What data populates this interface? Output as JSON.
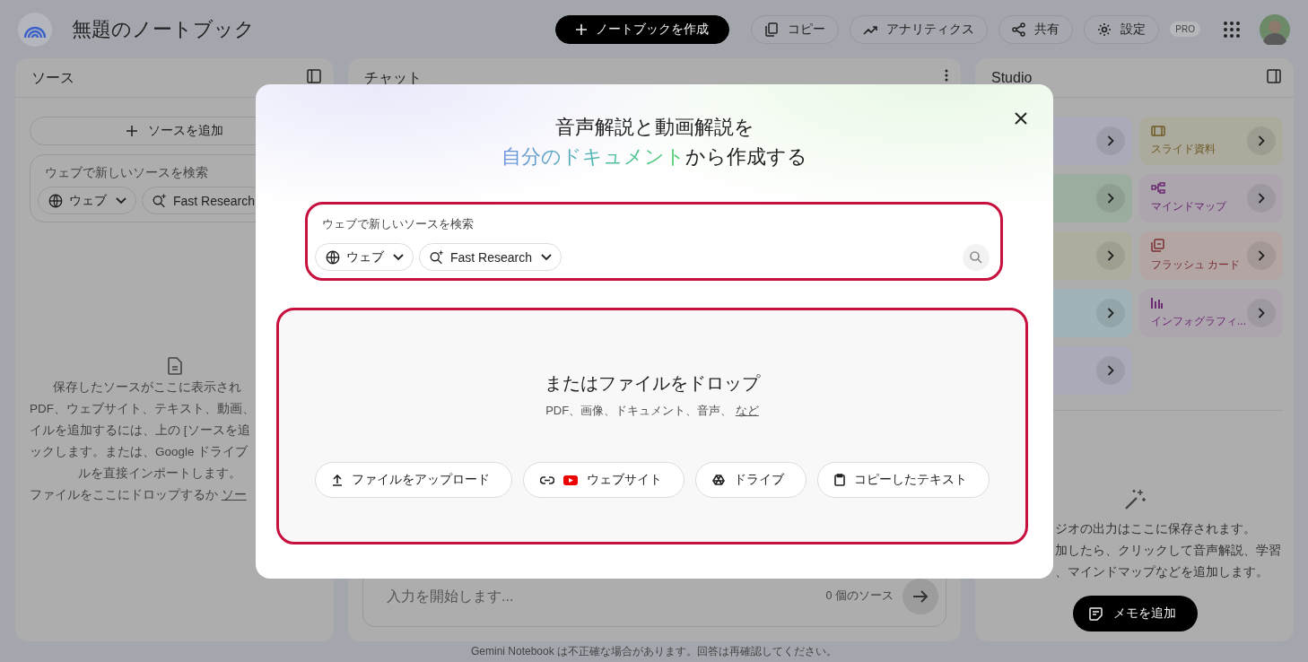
{
  "header": {
    "title": "無題のノートブック",
    "buttons": [
      {
        "label": "ノートブックを作成",
        "kind": "create"
      },
      {
        "label": "コピー",
        "kind": "copy"
      },
      {
        "label": "アナリティクス",
        "kind": "analytics"
      },
      {
        "label": "共有",
        "kind": "share"
      },
      {
        "label": "設定",
        "kind": "settings"
      }
    ],
    "badge": "PRO"
  },
  "sources_panel": {
    "title": "ソース",
    "add_button": "ソースを追加",
    "search": {
      "placeholder": "ウェブで新しいソースを検索",
      "chips": [
        {
          "label": "ウェブ",
          "kind": "web"
        },
        {
          "label": "Fast Research",
          "kind": "research"
        }
      ]
    },
    "empty_lines": [
      "保存したソースがここに表示され",
      "PDF、ウェブサイト、テキスト、動画、",
      "イルを追加するには、上の [ソースを追",
      "ックします。または、Google ドライブ",
      "ルを直接インポートします。",
      "ファイルをここにドロップするか "
    ],
    "empty_link": "ソー"
  },
  "chat_panel": {
    "title": "チャット",
    "input": {
      "placeholder": "入力を開始します..."
    },
    "source_count": "0 個のソース"
  },
  "studio_panel": {
    "title": "Studio",
    "cards": [
      {
        "color": "#a9abb8"
      },
      {
        "color": "#abaa9d",
        "label": "スライド資料",
        "kind": "slides"
      },
      {
        "color": "#9bad9f"
      },
      {
        "color": "#aca5ae",
        "label": "マインドマップ",
        "kind": "mindmap"
      },
      {
        "color": "#adac9e"
      },
      {
        "color": "#b2a5a4",
        "label": "フラッシュ カード",
        "kind": "flashcards"
      },
      {
        "color": "#a0b3b8"
      },
      {
        "color": "#aca5ae",
        "label": "インフォグラフィ...",
        "kind": "infographic"
      },
      {
        "color": "#a9abb8"
      }
    ],
    "empty_lines": [
      "ジオの出力はここに保存されます。",
      "加したら、クリックして音声解説、学習",
      "、マインドマップなどを追加します。"
    ],
    "add_note_button": "メモを追加"
  },
  "footer": "Gemini Notebook は不正確な場合があります。回答は再確認してください。",
  "dialog": {
    "title_line_1": "音声解説と動画解説を",
    "title_highlight": "自分のドキュメント",
    "title_rest": "から作成する",
    "search": {
      "placeholder": "ウェブで新しいソースを検索",
      "chips": [
        {
          "label": "ウェブ",
          "kind": "web"
        },
        {
          "label": "Fast Research",
          "kind": "research"
        }
      ]
    },
    "drop_title": "またはファイルをドロップ",
    "formats": "PDF、画像、ドキュメント、音声、 ",
    "formats_link": "など",
    "buttons": [
      {
        "label": "ファイルをアップロード",
        "kind": "upload"
      },
      {
        "label": "ウェブサイト",
        "kind": "website"
      },
      {
        "label": "ドライブ",
        "kind": "drive"
      },
      {
        "label": "コピーしたテキスト",
        "kind": "paste"
      }
    ]
  }
}
